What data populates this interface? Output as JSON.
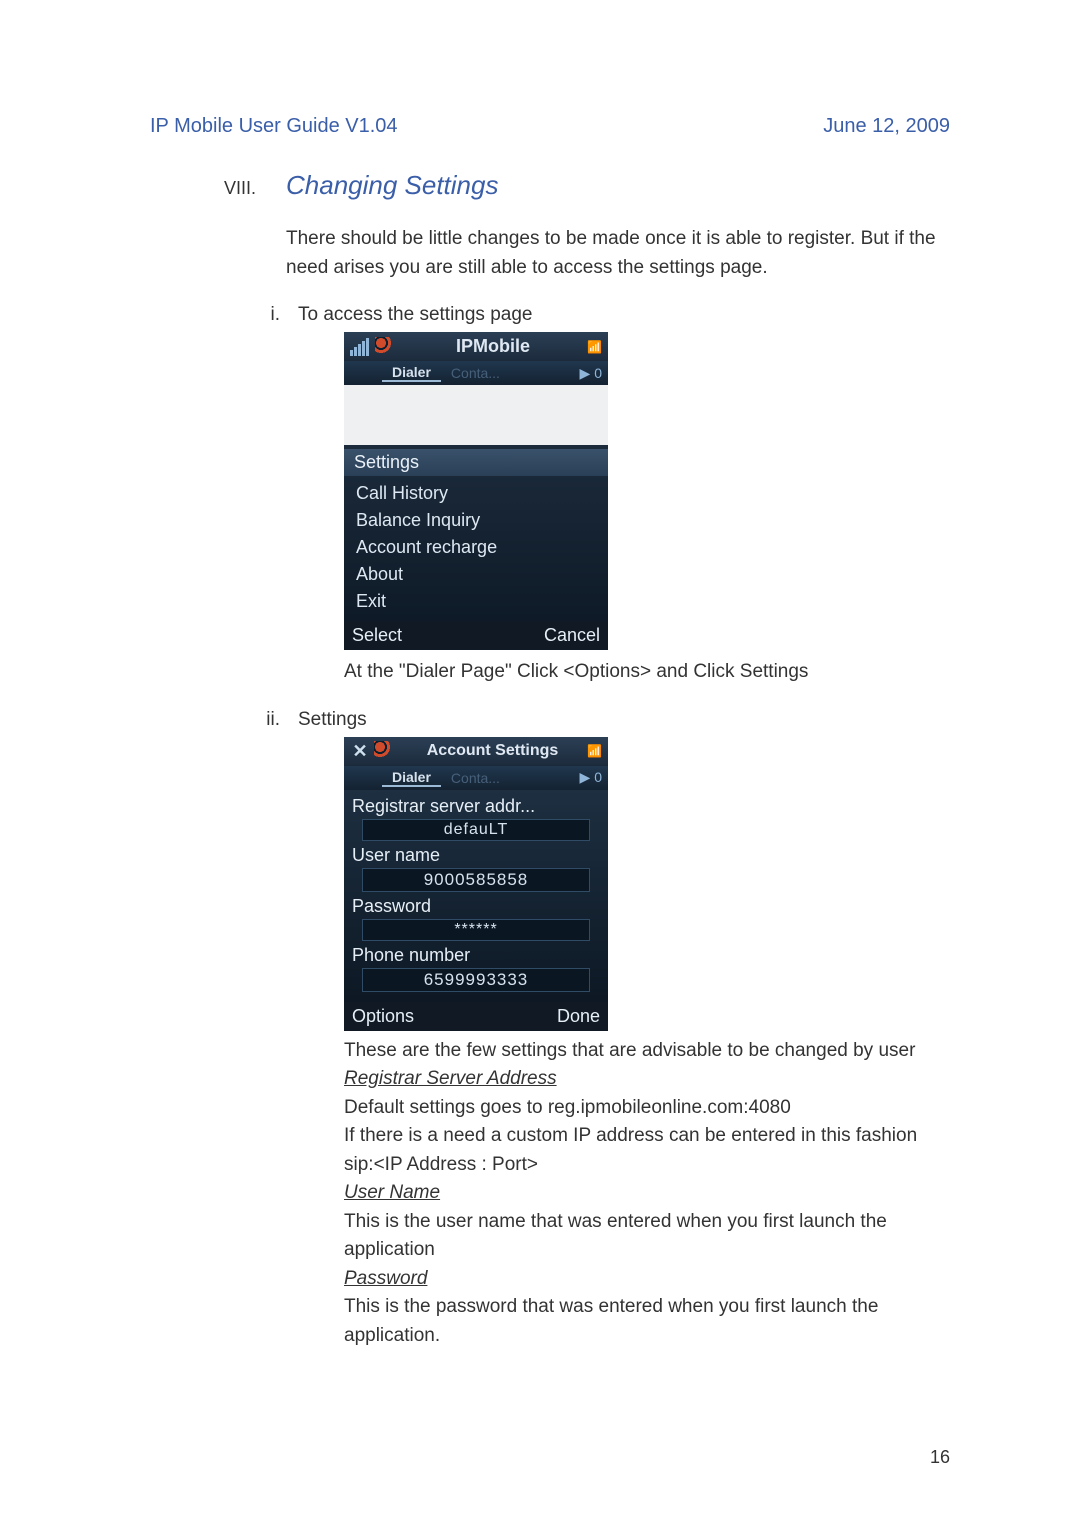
{
  "header": {
    "left": "IP Mobile User Guide V1.04",
    "right": "June 12, 2009"
  },
  "section": {
    "roman": "VIII.",
    "title": "Changing Settings",
    "intro": "There should be little changes to be made once it is able to register. But if the need arises you are still able to access the settings page."
  },
  "sub1": {
    "num": "i.",
    "label": "To access the settings page",
    "caption": "At the \"Dialer Page\" Click <Options> and Click Settings"
  },
  "sub2": {
    "num": "ii.",
    "label": "Settings"
  },
  "screenshot1": {
    "title": "IPMobile",
    "tabs": {
      "active": "Dialer",
      "dim": "Conta...",
      "arrow": "▶ 0"
    },
    "menu_head": "Settings",
    "menu_items": [
      "Call History",
      "Balance Inquiry",
      "Account recharge",
      "About",
      "Exit"
    ],
    "soft_left": "Select",
    "soft_right": "Cancel"
  },
  "screenshot2": {
    "title": "Account Settings",
    "tabs": {
      "active": "Dialer",
      "dim": "Conta...",
      "arrow": "▶ 0"
    },
    "fields": {
      "registrar_label": "Registrar server addr...",
      "registrar_value": "defauLT",
      "user_label": "User name",
      "user_value": "9000585858",
      "pwd_label": "Password",
      "pwd_value": "******",
      "phone_label": "Phone number",
      "phone_value": "6599993333"
    },
    "soft_left": "Options",
    "soft_right": "Done"
  },
  "body2": {
    "line1": "These are the few settings that are advisable to be changed by user",
    "reg_head": "Registrar Server Address",
    "reg_l1": "Default settings goes to reg.ipmobileonline.com:4080",
    "reg_l2": "If there is a need a custom  IP address can be entered in this fashion",
    "reg_l3": "sip:<IP Address : Port>",
    "user_head": "User Name",
    "user_l1": "This is the user name that was entered when you first launch the application",
    "pwd_head": "Password",
    "pwd_l1": "This is the password that was entered when you first launch the application."
  },
  "page_number": "16"
}
